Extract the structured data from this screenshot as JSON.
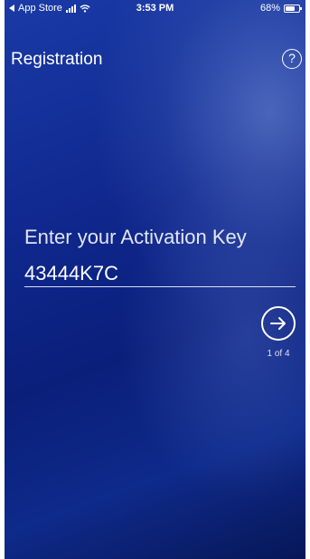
{
  "status_bar": {
    "back_label": "App Store",
    "time": "3:53 PM",
    "battery": "68%",
    "battery_level": 0.68
  },
  "header": {
    "title": "Registration",
    "help_label": "?"
  },
  "activation": {
    "label": "Enter your Activation Key",
    "value": "43444K7C"
  },
  "navigation": {
    "next_icon": "arrow-right-circle-icon",
    "step": "1 of 4"
  },
  "colors": {
    "background": "#10288f",
    "text": "#ffffff"
  }
}
